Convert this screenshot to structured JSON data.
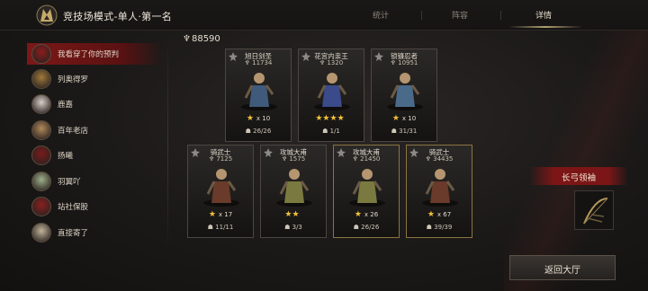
{
  "header": {
    "title": "竞技场模式-单人·第一名",
    "tabs": [
      {
        "label": "统计",
        "active": false
      },
      {
        "label": "阵容",
        "active": false
      },
      {
        "label": "详情",
        "active": true
      }
    ]
  },
  "sidebar": {
    "items": [
      {
        "label": "我看穿了你的预判",
        "selected": true,
        "avatar_color": "#8b1c1c"
      },
      {
        "label": "列奥得罗",
        "selected": false,
        "avatar_color": "#a07a3a"
      },
      {
        "label": "鹿嘉",
        "selected": false,
        "avatar_color": "#d8cfc8"
      },
      {
        "label": "百年老店",
        "selected": false,
        "avatar_color": "#b08a5a"
      },
      {
        "label": "扬曦",
        "selected": false,
        "avatar_color": "#7a1b1b"
      },
      {
        "label": "羽翼吖",
        "selected": false,
        "avatar_color": "#9fb08a"
      },
      {
        "label": "站社保股",
        "selected": false,
        "avatar_color": "#8a2020"
      },
      {
        "label": "直接寄了",
        "selected": false,
        "avatar_color": "#c2b49a"
      }
    ]
  },
  "power_total": "88590",
  "cards": [
    {
      "name": "旭日剑圣",
      "power": "11734",
      "stars": "★",
      "multiplier": "x 10",
      "troops": "26/26",
      "gold": false,
      "figure_color": "#3f5a7a"
    },
    {
      "name": "花宫内亲王",
      "power": "1320",
      "stars": "★★★★",
      "multiplier": "",
      "troops": "1/1",
      "gold": false,
      "figure_color": "#3a4a8a"
    },
    {
      "name": "锁镰忍者",
      "power": "10951",
      "stars": "★",
      "multiplier": "x 10",
      "troops": "31/31",
      "gold": false,
      "figure_color": "#4a6a8a"
    },
    {
      "name": "骑武士",
      "power": "7125",
      "stars": "★",
      "multiplier": "x 17",
      "troops": "11/11",
      "gold": false,
      "figure_color": "#6a3a2a"
    },
    {
      "name": "攻城大甫",
      "power": "1575",
      "stars": "★★",
      "multiplier": "",
      "troops": "3/3",
      "gold": false,
      "figure_color": "#7a7a40"
    },
    {
      "name": "攻城大甫",
      "power": "21450",
      "stars": "★",
      "multiplier": "x 26",
      "troops": "26/26",
      "gold": true,
      "figure_color": "#7a7a40"
    },
    {
      "name": "骑武士",
      "power": "34435",
      "stars": "★",
      "multiplier": "x 67",
      "troops": "39/39",
      "gold": true,
      "figure_color": "#6a3a2a"
    }
  ],
  "item": {
    "title": "长弓领袖"
  },
  "return_button": {
    "label": "返回大厅"
  }
}
